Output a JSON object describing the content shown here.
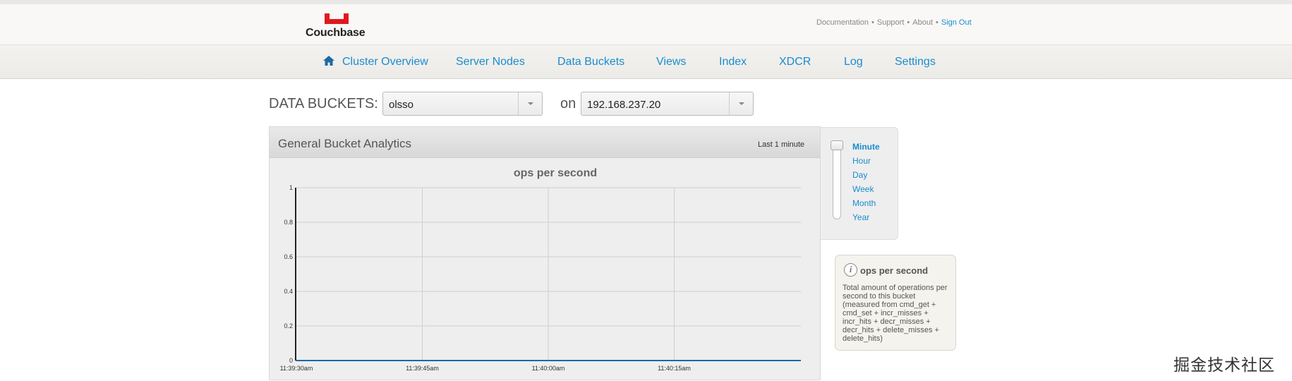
{
  "brand": {
    "name": "Couchbase",
    "logo_color": "#e0181f"
  },
  "top_links": [
    {
      "label": "Documentation"
    },
    {
      "label": "Support"
    },
    {
      "label": "About"
    },
    {
      "label": "Sign Out"
    }
  ],
  "nav": {
    "home_icon": "home-icon",
    "items": [
      {
        "label": "Cluster Overview"
      },
      {
        "label": "Server Nodes"
      },
      {
        "label": "Data Buckets"
      },
      {
        "label": "Views"
      },
      {
        "label": "Index"
      },
      {
        "label": "XDCR"
      },
      {
        "label": "Log"
      },
      {
        "label": "Settings"
      }
    ]
  },
  "buckets": {
    "label": "DATA BUCKETS:",
    "bucket_value": "olsso",
    "on_label": "on",
    "server_value": "192.168.237.20"
  },
  "panel": {
    "title": "General Bucket Analytics",
    "range_label": "Last 1 minute"
  },
  "chart_data": {
    "type": "line",
    "title": "ops per second",
    "xlabel": "",
    "ylabel": "",
    "x_ticks": [
      "11:39:30am",
      "11:39:45am",
      "11:40:00am",
      "11:40:15am"
    ],
    "y_ticks": [
      "1",
      "0.8",
      "0.6",
      "0.4",
      "0.2",
      "0"
    ],
    "ylim": [
      0,
      1
    ],
    "series": [
      {
        "values": [
          0,
          0,
          0,
          0,
          0
        ],
        "color": "#1a6aa5"
      }
    ],
    "grid": true
  },
  "time_options": [
    {
      "label": "Minute",
      "active": true
    },
    {
      "label": "Hour",
      "active": false
    },
    {
      "label": "Day",
      "active": false
    },
    {
      "label": "Week",
      "active": false
    },
    {
      "label": "Month",
      "active": false
    },
    {
      "label": "Year",
      "active": false
    }
  ],
  "info": {
    "title": "ops per second",
    "description": "Total amount of operations per second to this bucket (measured from cmd_get + cmd_set + incr_misses + incr_hits + decr_misses + decr_hits + delete_misses + delete_hits)"
  },
  "watermark": "掘金技术社区",
  "colors": {
    "link": "#1a8ccf",
    "accent": "#e0181f"
  }
}
